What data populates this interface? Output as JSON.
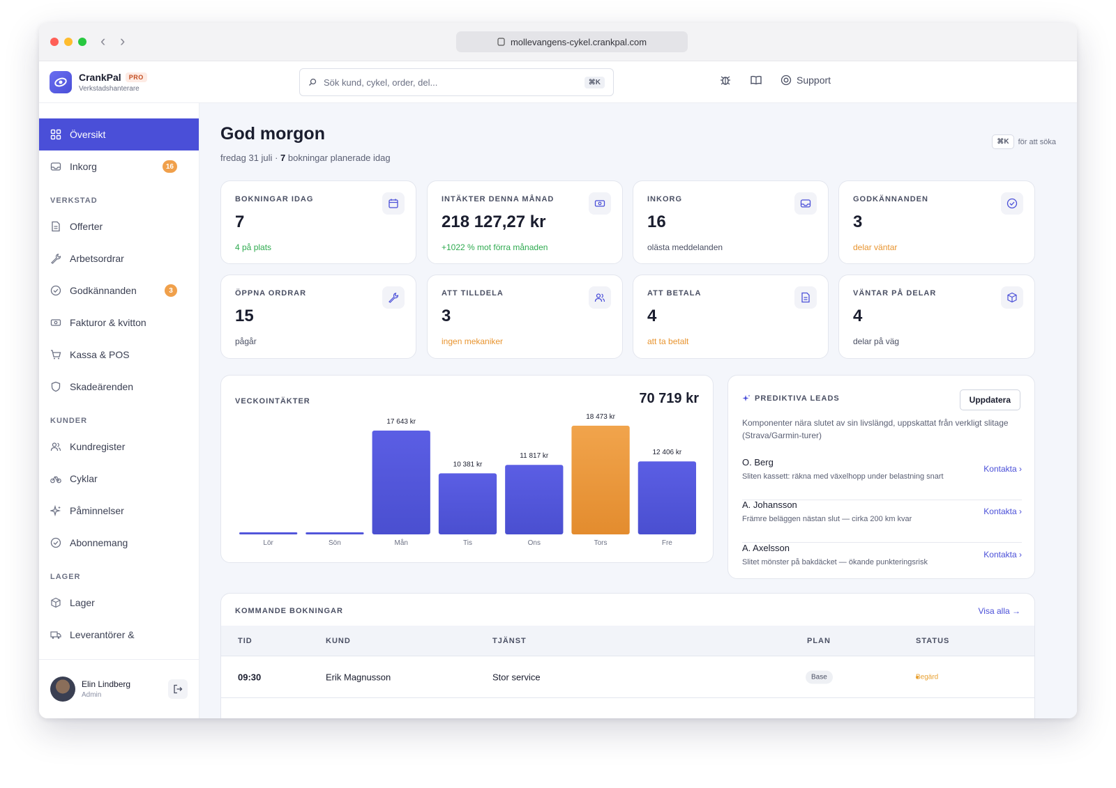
{
  "browser": {
    "url": "mollevangens-cykel.crankpal.com"
  },
  "brand": {
    "name": "CrankPal",
    "tier": "PRO",
    "subtitle": "Verkstadshanterare"
  },
  "search": {
    "placeholder": "Sök kund, cykel, order, del...",
    "shortcut": "⌘K"
  },
  "topbar": {
    "support_label": "Support"
  },
  "sidebar": {
    "top": [
      {
        "label": "Översikt",
        "active": true,
        "icon": "grid-icon"
      },
      {
        "label": "Inkorg",
        "badge": "16",
        "icon": "inbox-icon"
      }
    ],
    "sections": [
      {
        "title": "VERKSTAD",
        "items": [
          {
            "label": "Offerter",
            "icon": "document-icon"
          },
          {
            "label": "Arbetsordrar",
            "icon": "wrench-icon"
          },
          {
            "label": "Godkännanden",
            "badge": "3",
            "icon": "check-circle-icon"
          },
          {
            "label": "Fakturor & kvitton",
            "icon": "money-icon"
          },
          {
            "label": "Kassa & POS",
            "icon": "cart-icon"
          },
          {
            "label": "Skadeärenden",
            "icon": "shield-icon"
          }
        ]
      },
      {
        "title": "KUNDER",
        "items": [
          {
            "label": "Kundregister",
            "icon": "users-icon"
          },
          {
            "label": "Cyklar",
            "icon": "bike-icon"
          },
          {
            "label": "Påminnelser",
            "icon": "sparkle-icon"
          },
          {
            "label": "Abonnemang",
            "icon": "check-circle-icon"
          }
        ]
      },
      {
        "title": "LAGER",
        "items": [
          {
            "label": "Lager",
            "icon": "box-icon"
          },
          {
            "label": "Leverantörer &",
            "icon": "truck-icon"
          }
        ]
      }
    ],
    "user": {
      "name": "Elin Lindberg",
      "role": "Admin"
    }
  },
  "main": {
    "greeting": "God morgon",
    "date": "fredag 31 juli",
    "separator": " · ",
    "bookings_count": "7",
    "bookings_text": " bokningar planerade idag",
    "kbd_hint": {
      "key": "⌘K",
      "text": "för att söka"
    }
  },
  "stats": [
    {
      "label": "BOKNINGAR IDAG",
      "value": "7",
      "note": "4 på plats",
      "note_color": "#2eaa4f",
      "icon": "calendar-icon"
    },
    {
      "label": "INTÄKTER DENNA MÅNAD",
      "value": "218 127,27 kr",
      "note": "+1022 % mot förra månaden",
      "note_color": "#2eaa4f",
      "icon": "money-icon"
    },
    {
      "label": "INKORG",
      "value": "16",
      "note": "olästa meddelanden",
      "note_color": "#4a4f63",
      "icon": "inbox-icon"
    },
    {
      "label": "GODKÄNNANDEN",
      "value": "3",
      "note": "delar väntar",
      "note_color": "#e8942f",
      "icon": "check-circle-icon"
    },
    {
      "label": "ÖPPNA ORDRAR",
      "value": "15",
      "note": "pågår",
      "note_color": "#4a4f63",
      "icon": "wrench-icon"
    },
    {
      "label": "ATT TILLDELA",
      "value": "3",
      "note": "ingen mekaniker",
      "note_color": "#e8942f",
      "icon": "users-icon"
    },
    {
      "label": "ATT BETALA",
      "value": "4",
      "note": "att ta betalt",
      "note_color": "#e8942f",
      "icon": "document-icon"
    },
    {
      "label": "VÄNTAR PÅ DELAR",
      "value": "4",
      "note": "delar på väg",
      "note_color": "#4a4f63",
      "icon": "box-icon"
    }
  ],
  "chart_data": {
    "type": "bar",
    "title": "VECKOINTÄKTER",
    "total": "70 719 kr",
    "categories": [
      "Lör",
      "Sön",
      "Mån",
      "Tis",
      "Ons",
      "Tors",
      "Fre"
    ],
    "values": [
      0,
      0,
      17643,
      10381,
      11817,
      18473,
      12406
    ],
    "value_labels": [
      "",
      "",
      "17 643 kr",
      "10 381 kr",
      "11 817 kr",
      "18 473 kr",
      "12 406 kr"
    ],
    "highlight_index": 5,
    "ylim": [
      0,
      18473
    ],
    "colors": {
      "bar": "#5457de",
      "highlight": "#ee9a3f"
    },
    "grid": false,
    "legend": "none"
  },
  "leads": {
    "title": "PREDIKTIVA LEADS",
    "button": "Uppdatera",
    "description": "Komponenter nära slutet av sin livslängd, uppskattat från verkligt slitage (Strava/Garmin-turer)",
    "items": [
      {
        "name": "O. Berg",
        "desc": "Sliten kassett: räkna med växelhopp under belastning snart",
        "action": "Kontakta ›"
      },
      {
        "name": "A. Johansson",
        "desc": "Främre beläggen nästan slut — cirka 200 km kvar",
        "action": "Kontakta ›"
      },
      {
        "name": "A. Axelsson",
        "desc": "Slitet mönster på bakdäcket — ökande punkteringsrisk",
        "action": "Kontakta ›"
      }
    ]
  },
  "bookings": {
    "title": "KOMMANDE BOKNINGAR",
    "link": "Visa alla →",
    "columns": [
      "TID",
      "KUND",
      "TJÄNST",
      "PLAN",
      "STATUS"
    ],
    "rows": [
      {
        "time": "09:30",
        "customer": "Erik Magnusson",
        "service": "Stor service",
        "plan": "Base",
        "status": "Begärd"
      }
    ]
  }
}
